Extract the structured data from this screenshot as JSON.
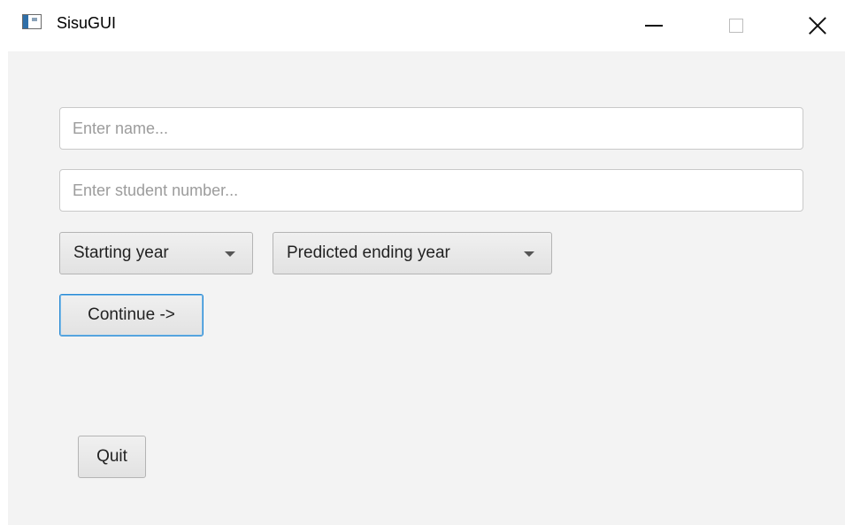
{
  "window": {
    "title": "SisuGUI",
    "icon": "java-app-icon",
    "controls": [
      "minimize-icon",
      "maximize-icon",
      "close-icon"
    ]
  },
  "form": {
    "name_placeholder": "Enter name...",
    "name_value": "",
    "student_number_placeholder": "Enter student number...",
    "student_number_value": "",
    "starting_year_label": "Starting year",
    "ending_year_label": "Predicted ending year",
    "continue_label": "Continue ->",
    "quit_label": "Quit"
  },
  "colors": {
    "focus_border": "#2a8ad4",
    "background": "#f3f3f3"
  }
}
